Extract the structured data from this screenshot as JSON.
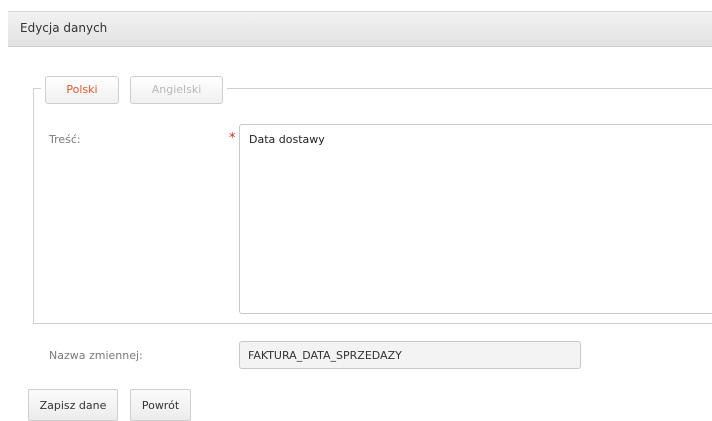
{
  "header": {
    "title": "Edycja danych"
  },
  "tabs": [
    {
      "label": "Polski",
      "active": true
    },
    {
      "label": "Angielski",
      "active": false
    }
  ],
  "form": {
    "content_label": "Treść:",
    "required_marker": "*",
    "content_value": "Data dostawy",
    "variable_label": "Nazwa zmiennej:",
    "variable_value": "FAKTURA_DATA_SPRZEDAZY"
  },
  "actions": {
    "save_label": "Zapisz dane",
    "back_label": "Powrót"
  },
  "colors": {
    "active_tab": "#e2572c",
    "inactive_tab": "#b8b8b8",
    "required": "#d32c1f"
  }
}
